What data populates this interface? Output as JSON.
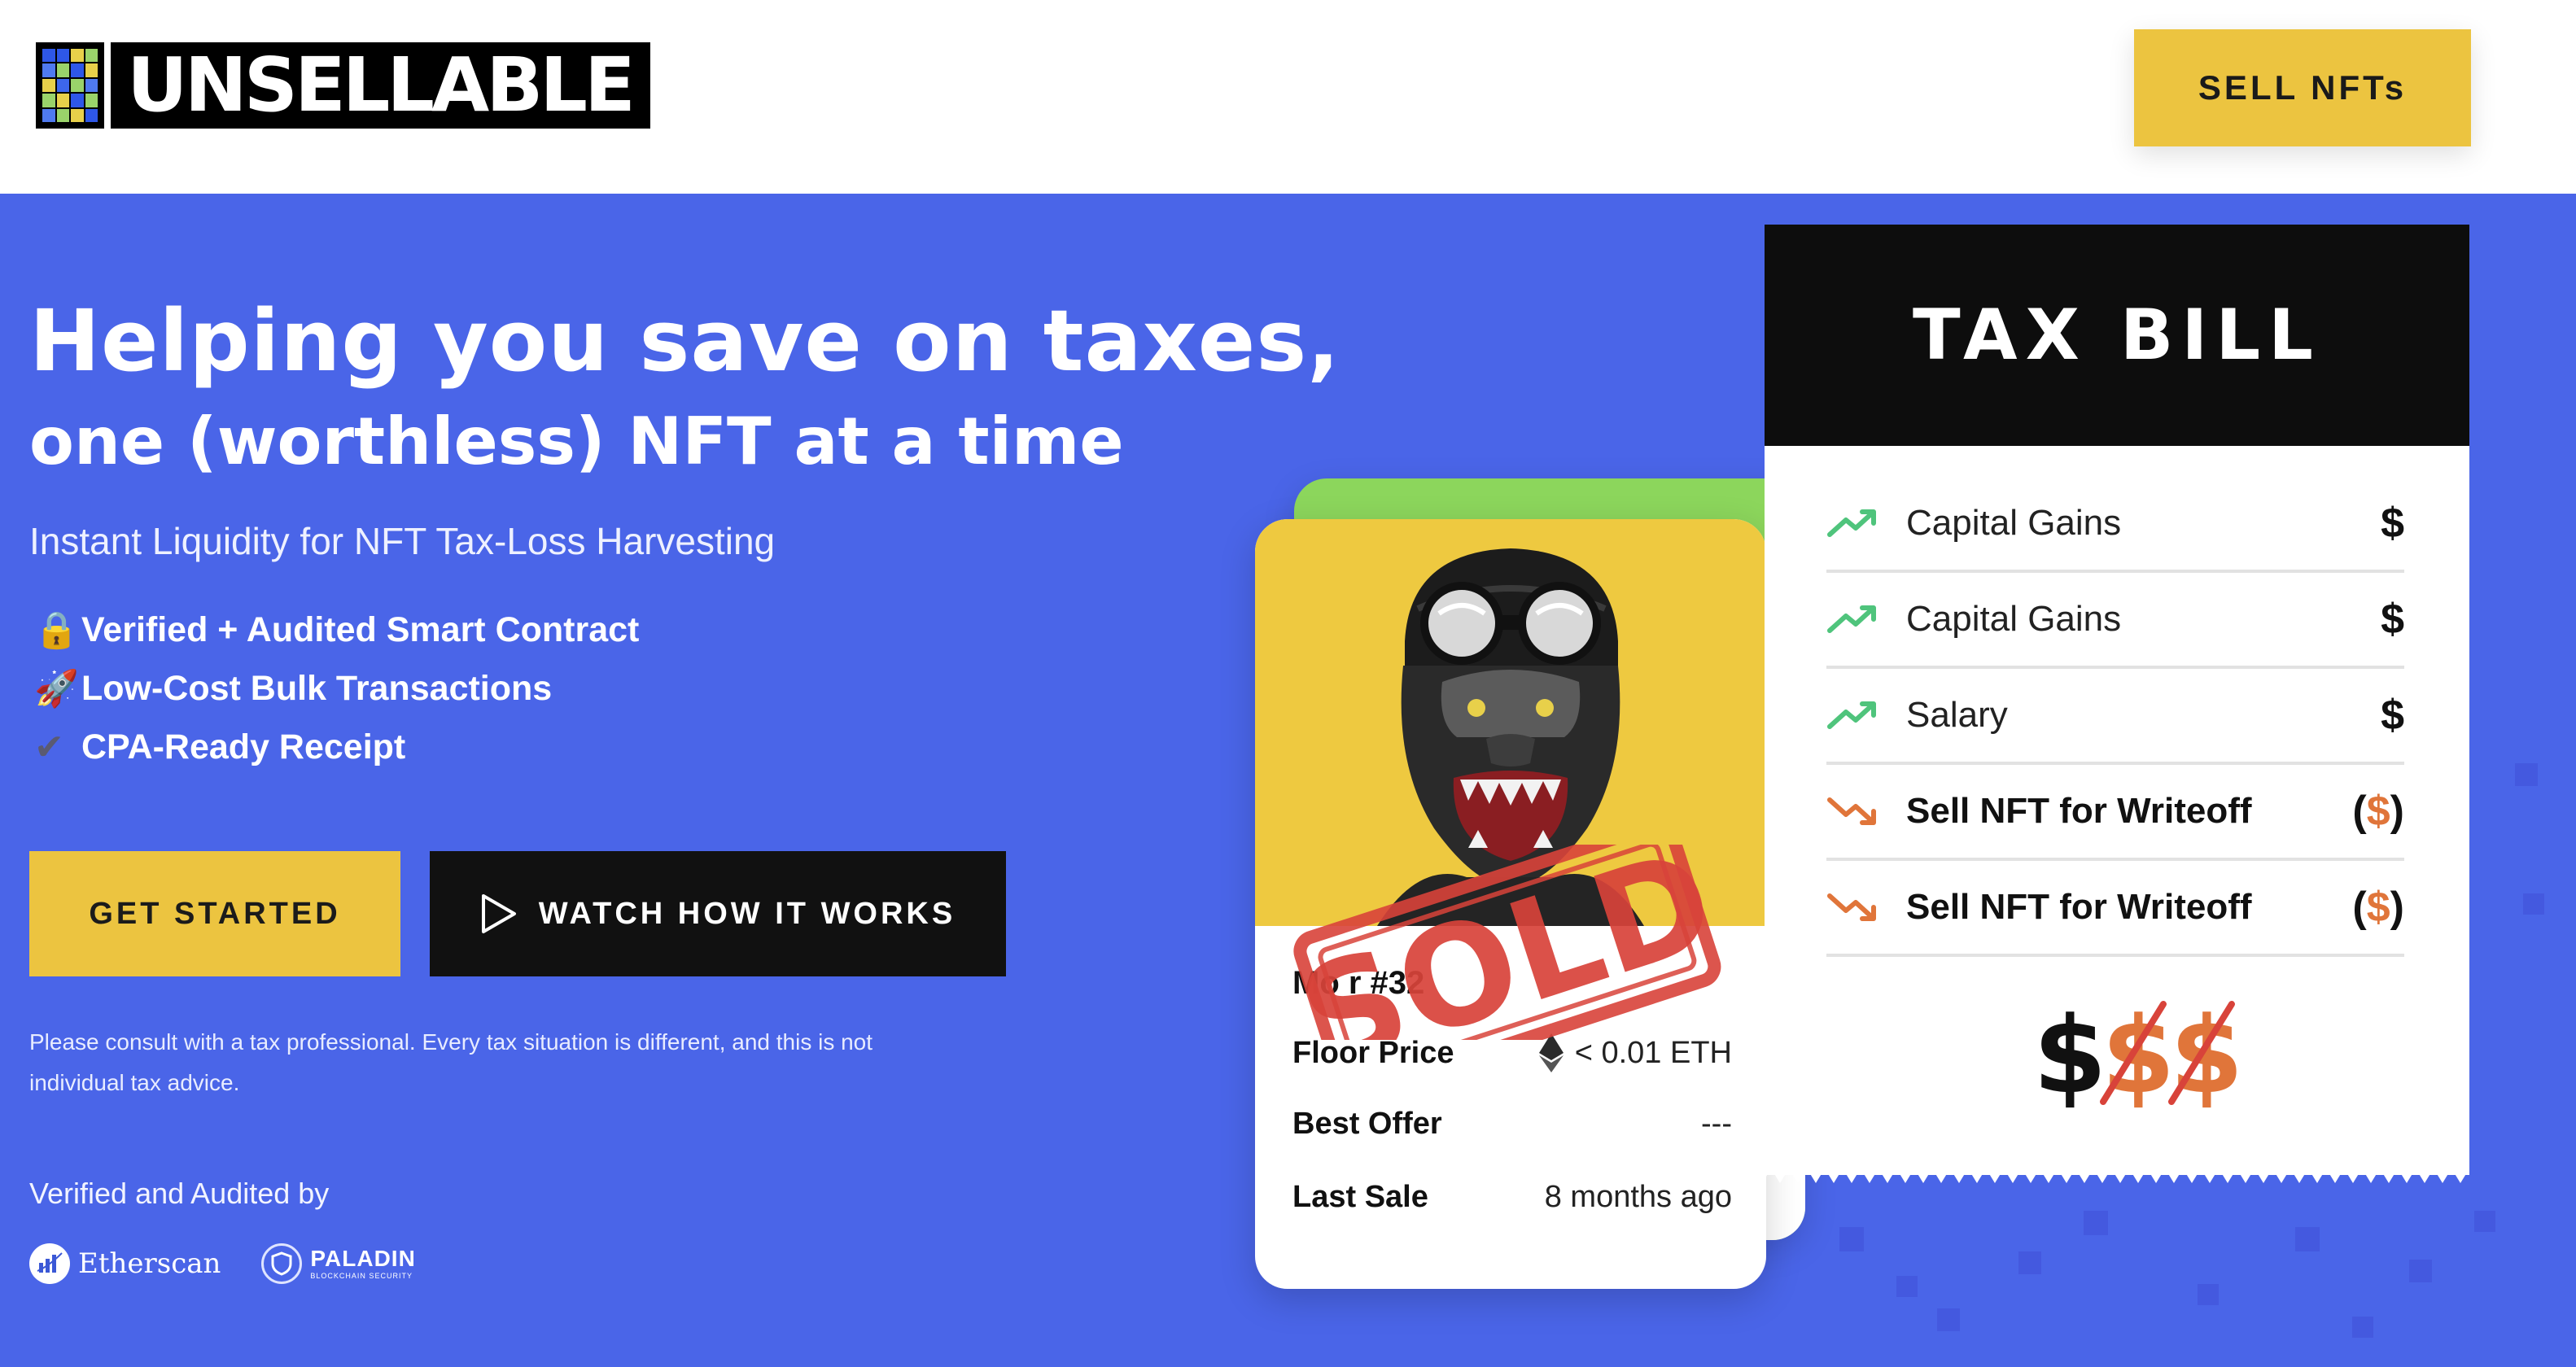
{
  "header": {
    "brand": "UNSELLABLE",
    "sell_button": "SELL NFTs"
  },
  "hero": {
    "headline_1": "Helping you save on taxes,",
    "headline_2": "one (worthless) NFT at a time",
    "subtitle": "Instant Liquidity for NFT Tax-Loss Harvesting",
    "features": [
      {
        "icon": "lock-icon",
        "glyph": "🔒",
        "text": "Verified + Audited Smart Contract"
      },
      {
        "icon": "rocket-icon",
        "glyph": "🚀",
        "text": "Low-Cost Bulk Transactions"
      },
      {
        "icon": "checkmark-icon",
        "glyph": "✔",
        "text": "CPA-Ready Receipt"
      }
    ],
    "get_started": "GET STARTED",
    "watch": "WATCH HOW IT WORKS",
    "disclaimer": "Please consult with a tax professional. Every tax situation is different, and this is not individual tax advice.",
    "verified_by": "Verified and Audited by",
    "partners": {
      "etherscan": "Etherscan",
      "paladin": "PALADIN",
      "paladin_sub": "BLOCKCHAIN SECURITY"
    }
  },
  "nft_card": {
    "name": "Mo    r   #32",
    "rows": [
      {
        "label": "Floor Price",
        "value": "< 0.01 ETH"
      },
      {
        "label": "Best Offer",
        "value": "---"
      },
      {
        "label": "Last Sale",
        "value": "8 months ago"
      }
    ],
    "stamp": "SOLD"
  },
  "tax_bill": {
    "title": "TAX BILL",
    "rows": [
      {
        "label": "Capital Gains",
        "amount": "$",
        "trend": "up"
      },
      {
        "label": "Capital Gains",
        "amount": "$",
        "trend": "up"
      },
      {
        "label": "Salary",
        "amount": "$",
        "trend": "up"
      },
      {
        "label": "Sell NFT for Writeoff",
        "amount_open": "(",
        "amount_sign": "$",
        "amount_close": ")",
        "trend": "down"
      },
      {
        "label": "Sell NFT for Writeoff",
        "amount_open": "(",
        "amount_sign": "$",
        "amount_close": ")",
        "trend": "down"
      }
    ],
    "total": "$$$"
  },
  "colors": {
    "hero_blue": "#4a65e8",
    "accent_yellow": "#ecc440",
    "up_green": "#4fc47c",
    "down_orange": "#e0753a",
    "stamp_red": "#d8433a"
  }
}
